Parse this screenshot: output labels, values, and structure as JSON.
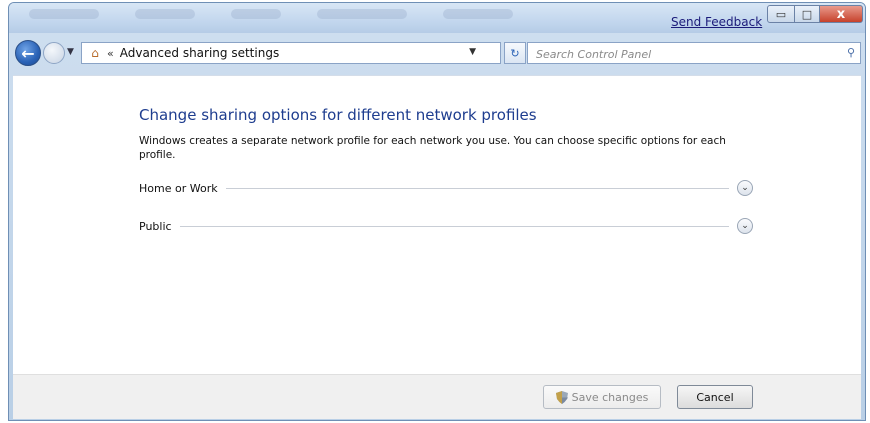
{
  "window": {
    "send_feedback": "Send Feedback",
    "buttons": {
      "minimize": "▭",
      "maximize": "□",
      "close": "x"
    }
  },
  "nav": {
    "address_separator": "«",
    "address_text": "Advanced sharing settings",
    "search_placeholder": "Search Control Panel"
  },
  "main": {
    "title": "Change sharing options for different network profiles",
    "description": "Windows creates a separate network profile for each network you use. You can choose specific options for each profile.",
    "profiles": [
      {
        "label": "Home or Work"
      },
      {
        "label": "Public"
      }
    ]
  },
  "footer": {
    "save_label": "Save changes",
    "cancel_label": "Cancel"
  },
  "colors": {
    "title": "#1e3d8f",
    "window_frame": "#b9cfe6"
  },
  "icons": [
    "back-arrow-icon",
    "forward-arrow-icon",
    "control-panel-home-icon",
    "refresh-icon",
    "search-icon",
    "chevron-down-icon",
    "shield-icon"
  ]
}
